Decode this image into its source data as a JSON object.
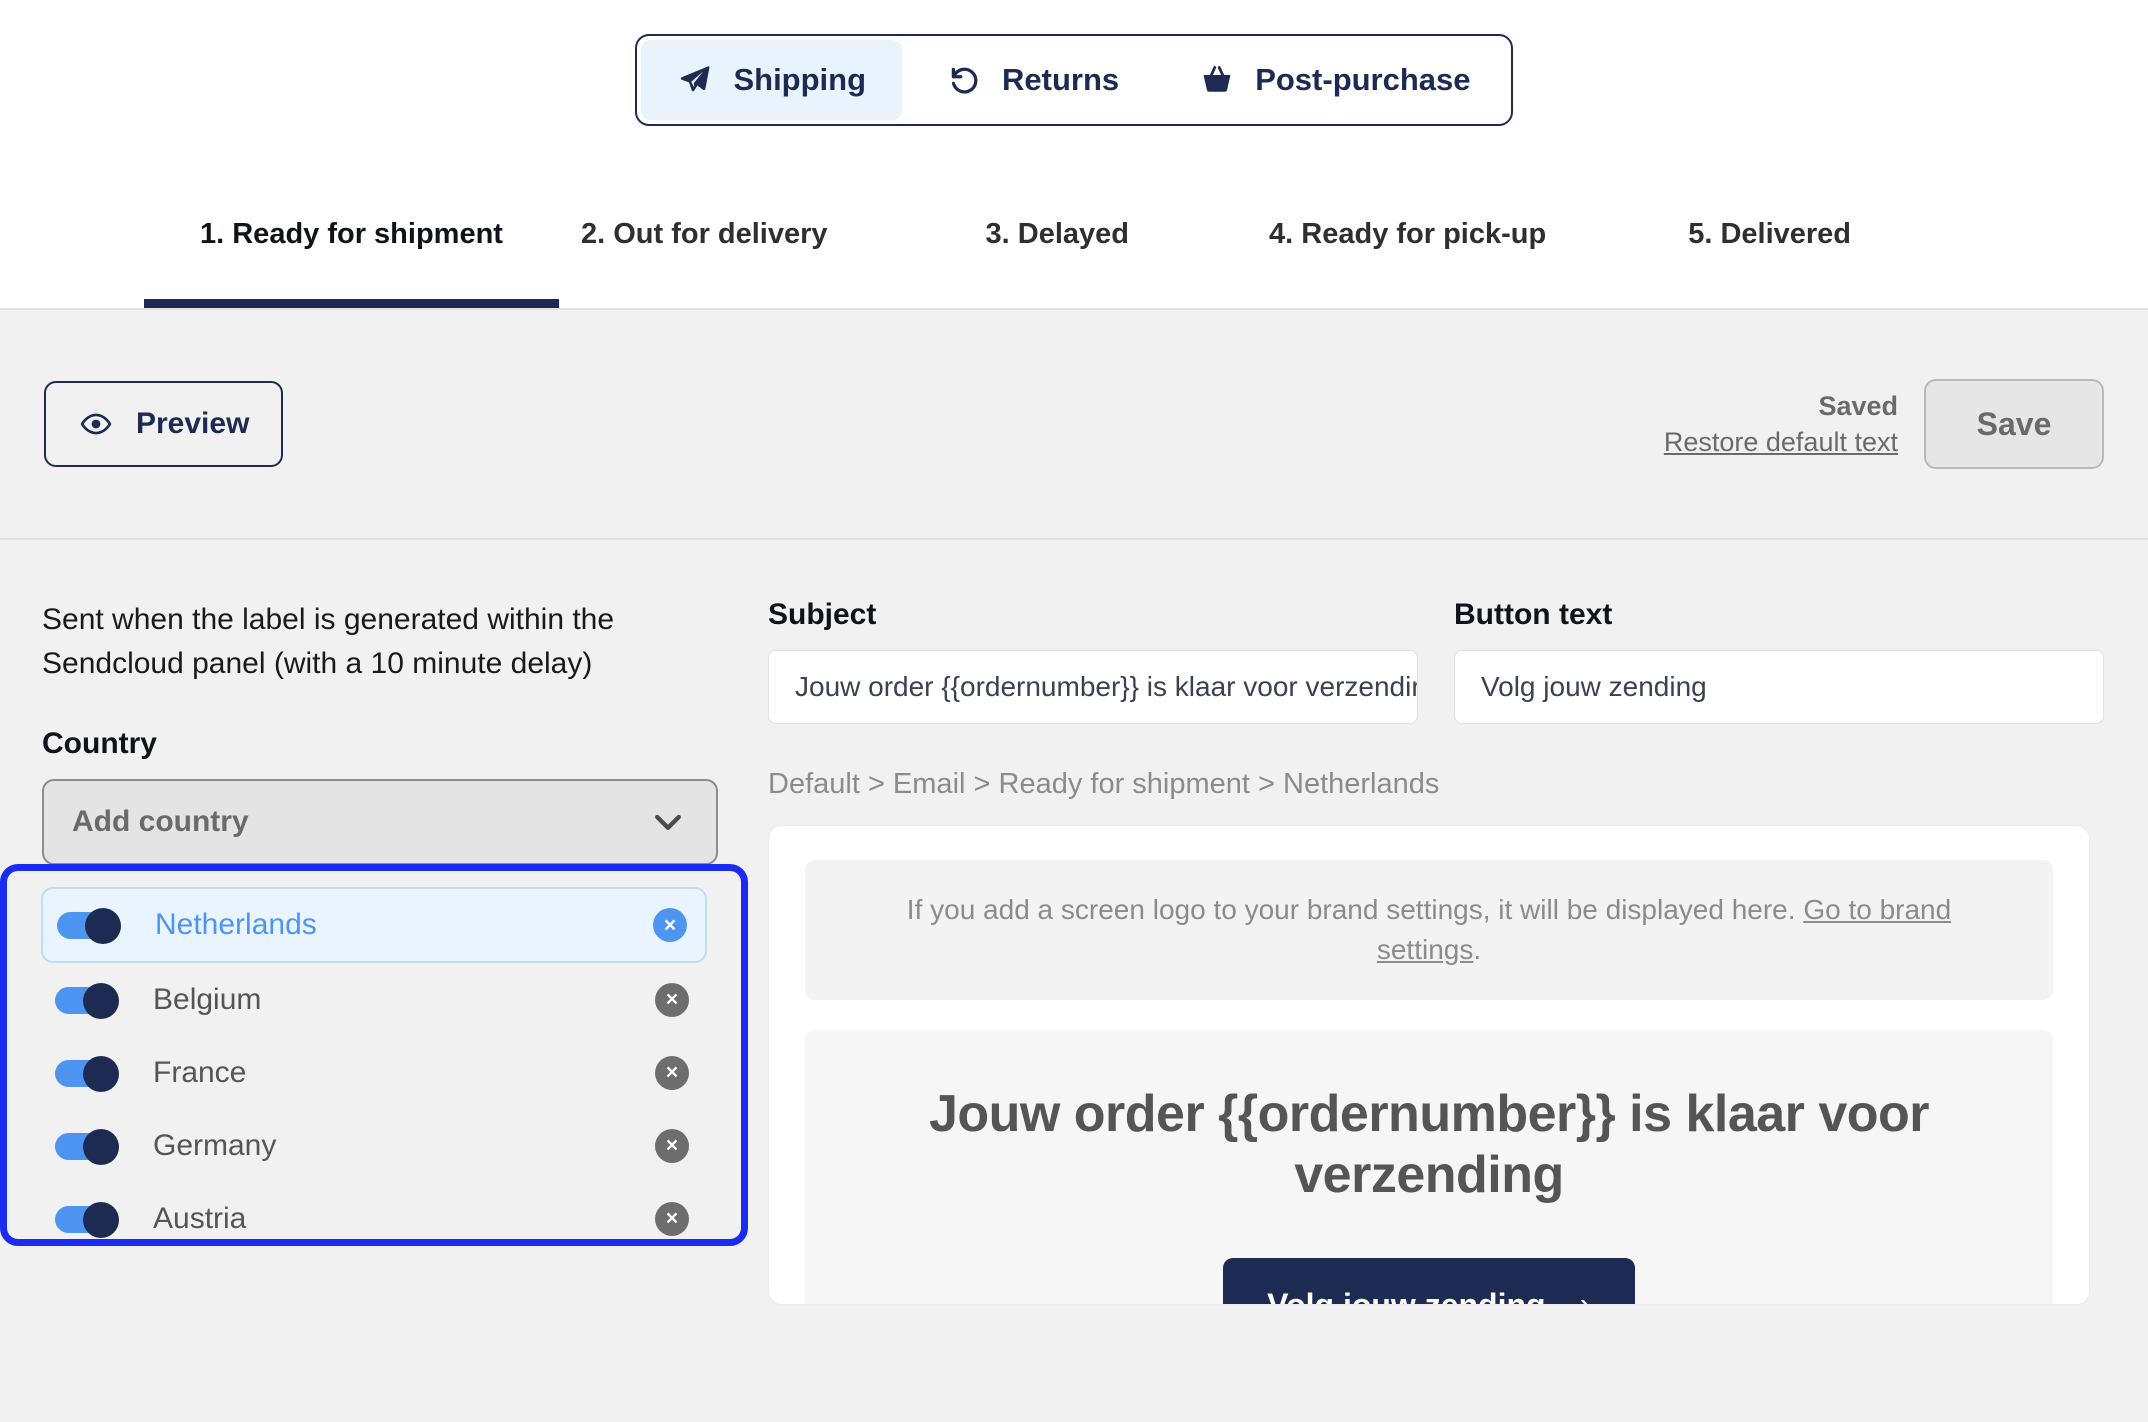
{
  "channels": [
    {
      "label": "Shipping",
      "icon": "paper-plane-icon",
      "active": true
    },
    {
      "label": "Returns",
      "icon": "undo-arrow-icon",
      "active": false
    },
    {
      "label": "Post-purchase",
      "icon": "basket-icon",
      "active": false
    }
  ],
  "stage_tabs": [
    {
      "label": "1. Ready for shipment",
      "active": true
    },
    {
      "label": "2. Out for delivery",
      "active": false
    },
    {
      "label": "3. Delayed",
      "active": false
    },
    {
      "label": "4. Ready for pick-up",
      "active": false
    },
    {
      "label": "5. Delivered",
      "active": false
    }
  ],
  "toolbar": {
    "preview_label": "Preview",
    "saved_status": "Saved",
    "restore_label": "Restore default text",
    "save_label": "Save"
  },
  "left": {
    "description": "Sent when the label is generated within the Sendcloud panel (with a 10 minute delay)",
    "country_label": "Country",
    "country_placeholder": "Add country",
    "countries": [
      {
        "name": "Netherlands",
        "enabled": true,
        "selected": true
      },
      {
        "name": "Belgium",
        "enabled": true,
        "selected": false
      },
      {
        "name": "France",
        "enabled": true,
        "selected": false
      },
      {
        "name": "Germany",
        "enabled": true,
        "selected": false
      },
      {
        "name": "Austria",
        "enabled": true,
        "selected": false
      }
    ],
    "remove_glyph": "×"
  },
  "right": {
    "subject_label": "Subject",
    "subject_value": "Jouw order {{ordernumber}} is klaar voor verzendin",
    "button_text_label": "Button text",
    "button_text_value": "Volg jouw zending",
    "breadcrumb": "Default > Email > Ready for shipment > Netherlands"
  },
  "preview": {
    "logo_notice_text": "If you add a screen logo to your brand settings, it will be displayed here. ",
    "logo_notice_link": "Go to brand settings",
    "logo_notice_period": ".",
    "email_heading": "Jouw order {{ordernumber}} is klaar voor verzending",
    "cta_label": "Volg jouw zending",
    "cta_chevron": "›"
  },
  "colors": {
    "brand_navy": "#1d2b53",
    "accent_blue": "#4e95f2",
    "highlight_border": "#1a2cf0",
    "selected_row_bg": "#e9f4fe",
    "page_bg": "#f1f1f1"
  }
}
